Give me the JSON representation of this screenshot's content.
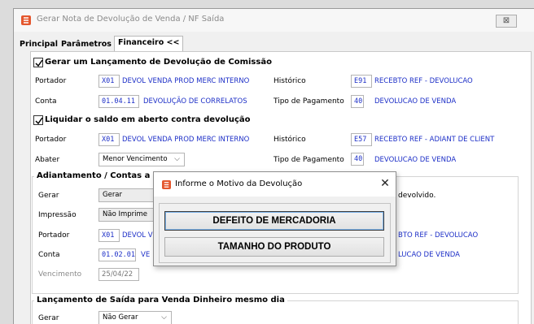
{
  "window": {
    "title": "Gerar Nota de Devolução de Venda / NF Saída",
    "close_glyph": "⊠"
  },
  "tabs": [
    {
      "label": "Principal"
    },
    {
      "label": "Parâmetros"
    },
    {
      "label": "Financeiro <<"
    }
  ],
  "comissao": {
    "checkbox_label": "Gerar um Lançamento de Devolução de Comissão",
    "checked": true,
    "portador_label": "Portador",
    "portador_code": "X01",
    "portador_desc": "DEVOL VENDA PROD MERC INTERNO",
    "historico_label": "Histórico",
    "historico_code": "E91",
    "historico_desc": "RECEBTO REF - DEVOLUCAO",
    "conta_label": "Conta",
    "conta_code": "01.04.11",
    "conta_desc": "DEVOLUÇÃO DE CORRELATOS",
    "tipo_label": "Tipo de Pagamento",
    "tipo_code": "40",
    "tipo_desc": "DEVOLUCAO DE VENDA"
  },
  "liquidar": {
    "checkbox_label": "Liquidar o saldo em aberto contra devolução",
    "checked": true,
    "portador_label": "Portador",
    "portador_code": "X01",
    "portador_desc": "DEVOL VENDA PROD MERC INTERNO",
    "historico_label": "Histórico",
    "historico_code": "E57",
    "historico_desc": "RECEBTO REF - ADIANT DE CLIENT",
    "abater_label": "Abater",
    "abater_value": "Menor Vencimento",
    "tipo_label": "Tipo de Pagamento",
    "tipo_code": "40",
    "tipo_desc": "DEVOLUCAO DE VENDA"
  },
  "adiantamento": {
    "title": "Adiantamento / Contas a P",
    "gerar_label": "Gerar",
    "gerar_value": "Gerar",
    "devolvido_text": "devolvido.",
    "impressao_label": "Impressão",
    "impressao_value": "Não Imprime",
    "portador_label": "Portador",
    "portador_code": "X01",
    "portador_desc": "DEVOL VE",
    "historico_desc": "BTO REF - DEVOLUCAO",
    "conta_label": "Conta",
    "conta_code": "01.02.01",
    "conta_desc": "VE",
    "tipo_desc": "LUCAO DE VENDA",
    "vencimento_label": "Vencimento",
    "vencimento_value": "25/04/22"
  },
  "saida": {
    "title": "Lançamento de Saída para Venda Dinheiro mesmo dia",
    "gerar_label": "Gerar",
    "gerar_value": "Não Gerar"
  },
  "dialog": {
    "title": "Informe o Motivo da Devolução",
    "close_glyph": "✕",
    "options": [
      {
        "label": "DEFEITO DE MERCADORIA"
      },
      {
        "label": "TAMANHO DO PRODUTO"
      }
    ]
  },
  "colors": {
    "link_blue": "#1d2fc7",
    "app_icon": "#e4572e"
  }
}
